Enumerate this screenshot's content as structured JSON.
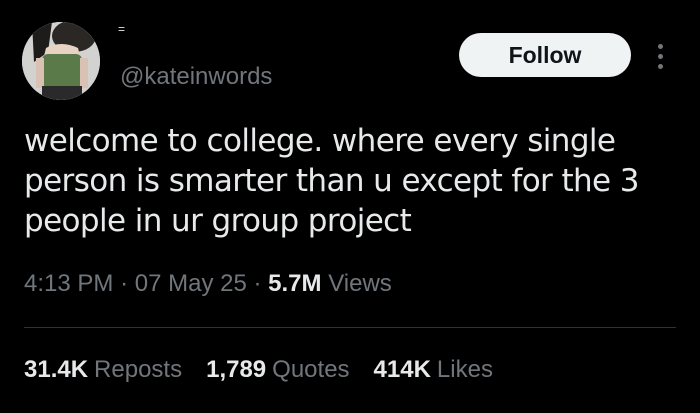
{
  "user": {
    "display_name": "=",
    "handle": "@kateinwords",
    "avatar": "profile-photo"
  },
  "actions": {
    "follow_label": "Follow",
    "more_icon": "more-vertical-icon"
  },
  "tweet": {
    "text": "welcome to college. where every single person is smarter than u except for the 3 people in ur group project"
  },
  "meta": {
    "time": "4:13 PM",
    "separator": "·",
    "date": "07 May 25",
    "views_count": "5.7M",
    "views_label": "Views"
  },
  "stats": {
    "reposts_count": "31.4K",
    "reposts_label": "Reposts",
    "quotes_count": "1,789",
    "quotes_label": "Quotes",
    "likes_count": "414K",
    "likes_label": "Likes"
  },
  "colors": {
    "background": "#000000",
    "text_primary": "#e7e9ea",
    "text_secondary": "#71767b",
    "button_bg": "#eff3f4",
    "divider": "#2f3336"
  }
}
